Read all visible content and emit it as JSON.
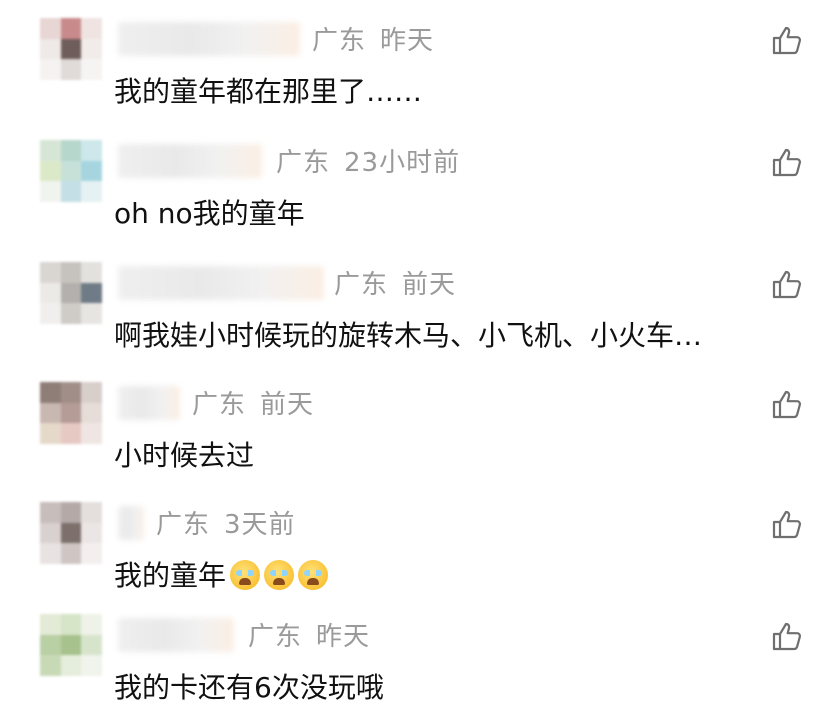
{
  "like_icon": "thumbs-up-icon",
  "comments": [
    {
      "location": "广东",
      "time": "昨天",
      "text": "我的童年都在那里了……",
      "emoji_count": 0,
      "avatar_colors": [
        "#e8d6d4",
        "#c98a8c",
        "#efe4e2",
        "#efe9e8",
        "#6e5d5a",
        "#f1ecea",
        "#f5f2f1",
        "#e0dad8",
        "#f6f4f3"
      ]
    },
    {
      "location": "广东",
      "time": "23小时前",
      "text": "oh no我的童年",
      "emoji_count": 0,
      "avatar_colors": [
        "#d6e6d6",
        "#b6d7cc",
        "#cde7ea",
        "#dbe9c8",
        "#c7e1d9",
        "#a6d5e0",
        "#f0f4ee",
        "#c4dfe6",
        "#e6f1f4"
      ]
    },
    {
      "location": "广东",
      "time": "前天",
      "text": "啊我娃小时候玩的旋转木马、小飞机、小火车…",
      "emoji_count": 0,
      "avatar_colors": [
        "#d9d6d2",
        "#c6c2be",
        "#e3e1de",
        "#eceae7",
        "#b3b0ad",
        "#6f7b86",
        "#f1efed",
        "#cfcbc7",
        "#e7e5e2"
      ]
    },
    {
      "location": "广东",
      "time": "前天",
      "text": "小时候去过",
      "emoji_count": 0,
      "avatar_colors": [
        "#8f7d78",
        "#a18e88",
        "#d8cfcb",
        "#c9b7b1",
        "#b59c96",
        "#e6dcd8",
        "#e5d9c9",
        "#e7c9c4",
        "#efe6e3"
      ]
    },
    {
      "location": "广东",
      "time": "3天前",
      "text": "我的童年",
      "emoji_count": 3,
      "avatar_colors": [
        "#c7bdbb",
        "#b4a9a7",
        "#e4dedd",
        "#d9d1cf",
        "#7c6f6c",
        "#ebe6e5",
        "#e8e3e2",
        "#cfc6c4",
        "#f2efee"
      ]
    },
    {
      "location": "广东",
      "time": "昨天",
      "text": "我的卡还有6次没玩哦",
      "emoji_count": 0,
      "avatar_colors": [
        "#e3ead6",
        "#d6e4c8",
        "#eef2e8",
        "#b9cfa4",
        "#a7c28d",
        "#d7e4cc",
        "#c8d9b6",
        "#e5eddc",
        "#f0f4ec"
      ]
    }
  ]
}
